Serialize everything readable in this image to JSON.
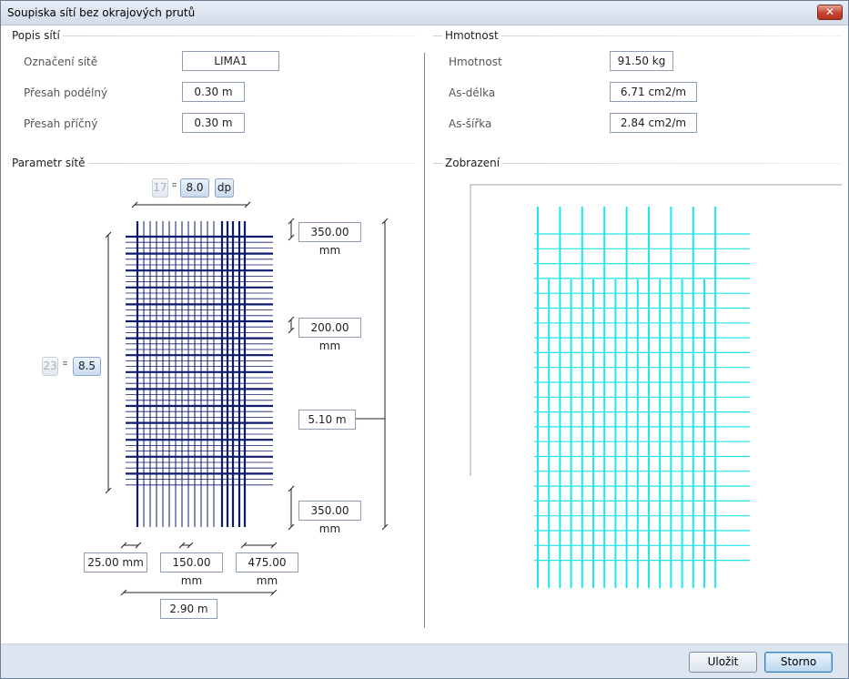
{
  "window": {
    "title": "Soupiska sítí bez okrajových prutů",
    "close_label": "✕"
  },
  "popis": {
    "group_title": "Popis sítí",
    "oznaceni_label": "Označení sítě",
    "oznaceni_value": "LIMA1",
    "presah_podelny_label": "Přesah podélný",
    "presah_podelny_value": "0.30 m",
    "presah_pricny_label": "Přesah příčný",
    "presah_pricny_value": "0.30 m"
  },
  "hmotnost": {
    "group_title": "Hmotnost",
    "hmotnost_label": "Hmotnost",
    "hmotnost_value": "91.50 kg",
    "as_delka_label": "As-délka",
    "as_delka_value": "6.71 cm2/m",
    "as_sirka_label": "As-šířka",
    "as_sirka_value": "2.84 cm2/m"
  },
  "parametr": {
    "group_title": "Parametr sítě",
    "top_count": "17",
    "top_diameter": "8.0",
    "top_dp": "dp",
    "left_count": "23",
    "left_diameter": "8.5",
    "hash_symbol": "⌗",
    "right_dim_top": "350.00 mm",
    "right_dim_mid": "200.00 mm",
    "right_dim_length": "5.10 m",
    "right_dim_bottom": "350.00 mm",
    "bottom_dim_left": "25.00 mm",
    "bottom_dim_mid": "150.00 mm",
    "bottom_dim_right": "475.00 mm",
    "bottom_dim_width": "2.90 m",
    "mesh_color": "#0d1a6e"
  },
  "zobrazeni": {
    "group_title": "Zobrazení",
    "mesh_color": "#1ee6ea"
  },
  "footer": {
    "save_label": "Uložit",
    "cancel_label": "Storno"
  }
}
